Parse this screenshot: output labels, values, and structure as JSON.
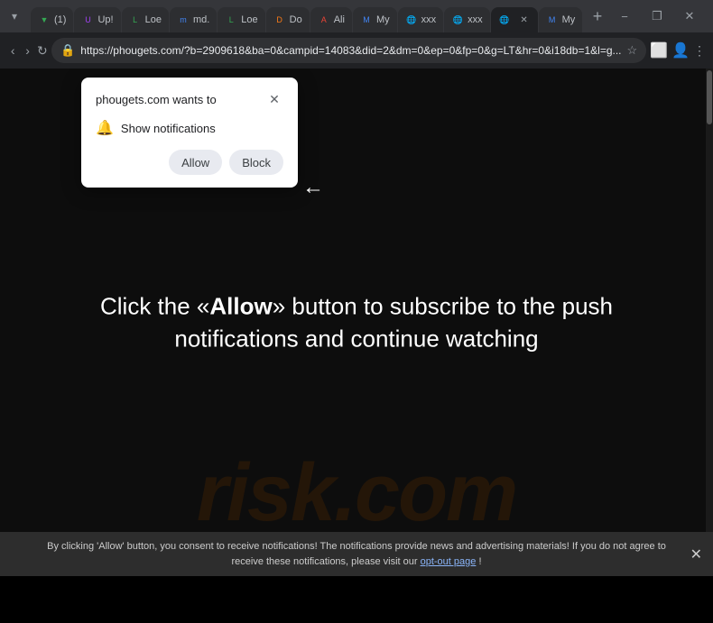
{
  "browser": {
    "tabs": [
      {
        "id": 1,
        "label": "(1)",
        "favicon": "▼",
        "favicon_color": "fav-green",
        "active": false
      },
      {
        "id": 2,
        "label": "Up!",
        "favicon": "U",
        "favicon_color": "fav-purple",
        "active": false
      },
      {
        "id": 3,
        "label": "Loe",
        "favicon": "L",
        "favicon_color": "fav-green",
        "active": false
      },
      {
        "id": 4,
        "label": "md.",
        "favicon": "m",
        "favicon_color": "fav-blue",
        "active": false
      },
      {
        "id": 5,
        "label": "Loe",
        "favicon": "L",
        "favicon_color": "fav-green",
        "active": false
      },
      {
        "id": 6,
        "label": "Do",
        "favicon": "D",
        "favicon_color": "fav-orange",
        "active": false
      },
      {
        "id": 7,
        "label": "Ali",
        "favicon": "A",
        "favicon_color": "fav-red",
        "active": false
      },
      {
        "id": 8,
        "label": "My",
        "favicon": "M",
        "favicon_color": "fav-blue",
        "active": false
      },
      {
        "id": 9,
        "label": "xxx",
        "favicon": "🌐",
        "favicon_color": "fav-globe",
        "active": false
      },
      {
        "id": 10,
        "label": "xxx",
        "favicon": "🌐",
        "favicon_color": "fav-globe",
        "active": false
      },
      {
        "id": 11,
        "label": "",
        "favicon": "🌐",
        "favicon_color": "fav-globe",
        "active": true
      },
      {
        "id": 12,
        "label": "My",
        "favicon": "M",
        "favicon_color": "fav-blue",
        "active": false
      }
    ],
    "new_tab_label": "+",
    "address": "https://phougets.com/?b=2909618&ba=0&campid=14083&did=2&dm=0&ep=0&fp=0&g=LT&hr=0&i18db=1&l=g...",
    "window_controls": [
      "−",
      "❐",
      "✕"
    ]
  },
  "nav": {
    "back_label": "‹",
    "forward_label": "›",
    "reload_label": "↻",
    "menu_label": "⋮"
  },
  "popup": {
    "title": "phougets.com wants to",
    "close_label": "✕",
    "notification_text": "Show notifications",
    "allow_label": "Allow",
    "block_label": "Block"
  },
  "page": {
    "main_text_before": "Click the «",
    "allow_word": "Allow",
    "main_text_after": "» button to subscribe to the push notifications and continue watching",
    "watermark": "risk.com"
  },
  "bottom_bar": {
    "text": "By clicking 'Allow' button, you consent to receive notifications! The notifications provide news and advertising materials! If you do not agree to receive these notifications, please visit our ",
    "opt_out_label": "opt-out page",
    "exclamation": "!",
    "close_label": "✕"
  }
}
